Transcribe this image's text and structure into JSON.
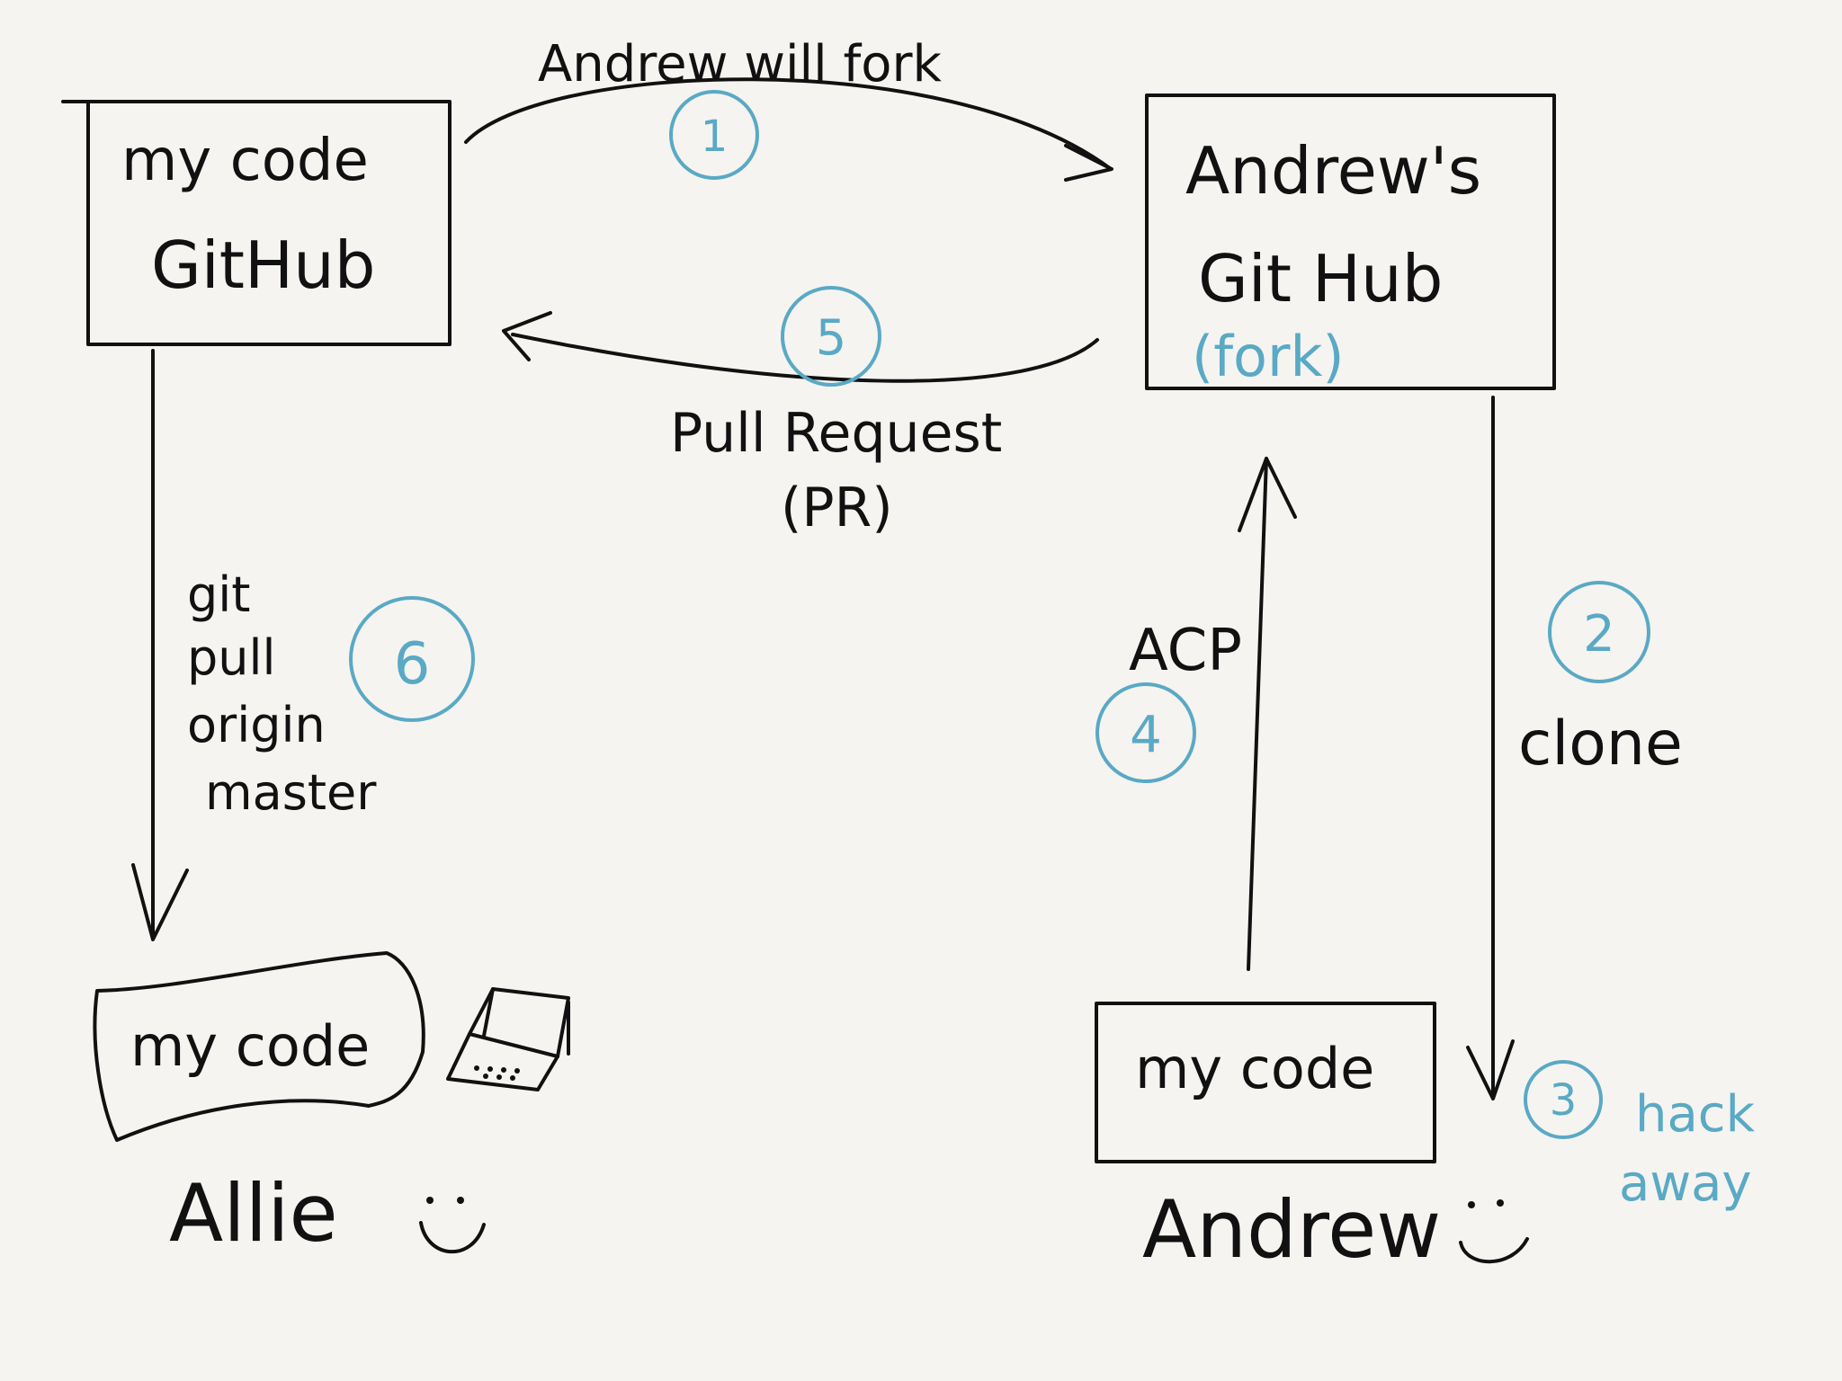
{
  "colors": {
    "ink": "#111111",
    "accent": "#5aa9c5",
    "background": "#f5f4f0"
  },
  "boxes": {
    "allie_github": {
      "line1": "my code",
      "line2": "GitHub"
    },
    "andrew_github": {
      "line1": "Andrew's",
      "line2": "Git Hub",
      "note": "(fork)"
    },
    "allie_local": {
      "label": "my code"
    },
    "andrew_local": {
      "label": "my code"
    }
  },
  "arrows": {
    "fork": {
      "label": "Andrew will fork"
    },
    "pull_request": {
      "line1": "Pull Request",
      "line2": "(PR)"
    },
    "git_pull": {
      "lines": [
        "git",
        "pull",
        "origin",
        "master"
      ]
    },
    "acp": {
      "label": "ACP"
    },
    "clone": {
      "label": "clone"
    }
  },
  "steps": [
    "1",
    "2",
    "3",
    "4",
    "5",
    "6"
  ],
  "step3_note": {
    "line1": "hack",
    "line2": "away"
  },
  "people": {
    "allie": "Allie",
    "andrew": "Andrew"
  },
  "icons": {
    "laptop": "laptop-icon",
    "smiley": "smiley-icon"
  }
}
